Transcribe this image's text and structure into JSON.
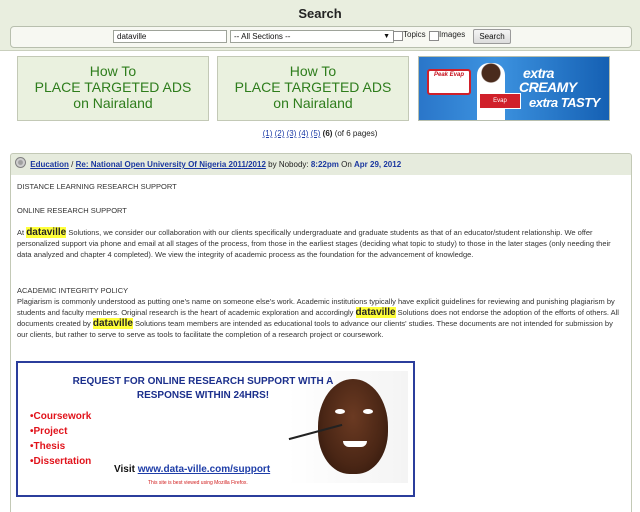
{
  "header": {
    "title": "Search"
  },
  "search": {
    "query": "dataville",
    "section": "-- All Sections --",
    "topics_label": "Topics",
    "images_label": "Images",
    "button": "Search"
  },
  "ads": [
    {
      "l1": "How To",
      "l2": "PLACE TARGETED ADS",
      "l3": "on Nairaland"
    },
    {
      "l1": "How To",
      "l2": "PLACE TARGETED ADS",
      "l3": "on Nairaland"
    }
  ],
  "banner": {
    "brand": "Peak Evap",
    "t1": "extra",
    "t2": "CREAMY",
    "t3": "extra TASTY",
    "pack": "Evap"
  },
  "pager": {
    "p1": "(1)",
    "p2": "(2)",
    "p3": "(3)",
    "p4": "(4)",
    "p5": "(5)",
    "current": "(6)",
    "total": "(of 6 pages)"
  },
  "post": {
    "board": "Education",
    "sep": "/",
    "thread": "Re: National Open University Of Nigeria 2011/2012",
    "by": "by Nobody:",
    "time": "8:22pm",
    "on": "On",
    "date": "Apr 29, 2012",
    "heading1": "DISTANCE LEARNING RESEARCH SUPPORT",
    "heading2": "ONLINE RESEARCH SUPPORT",
    "hl": "dataville",
    "para1_a": "At",
    "para1_b": "Solutions, we consider our collaboration with our clients specifically undergraduate and graduate students as that of an educator/student relationship. We offer personalized support via phone and email at all stages of the process, from those in the earliest stages (deciding what topic to study) to those in the later stages (only needing their data analyzed and chapter 4 completed). We view the integrity of academic process as the foundation for the advancement of knowledge.",
    "heading3": "ACADEMIC INTEGRITY POLICY",
    "para2_a": "Plagiarism is commonly understood as putting one's name on someone else's work. Academic institutions typically have explicit guidelines for reviewing and punishing plagiarism by students and faculty members. Original research is the heart of academic exploration and accordingly",
    "para2_b": "Solutions does not endorse the adoption of the efforts of others. All documents created by",
    "para2_c": "Solutions team members are intended as educational tools to advance our clients' studies. These documents are not intended for submission by our clients, but rather to serve to serve as tools to facilitate the completion of a research project or coursework."
  },
  "promo": {
    "head": "REQUEST FOR ONLINE RESEARCH SUPPORT WITH A RESPONSE WITHIN 24HRS!",
    "items": [
      "•Coursework",
      "•Project",
      "•Thesis",
      "•Dissertation"
    ],
    "visit": "Visit",
    "url": "www.data-ville.com/support",
    "note": "This site is best viewed using Mozilla Firefox."
  }
}
